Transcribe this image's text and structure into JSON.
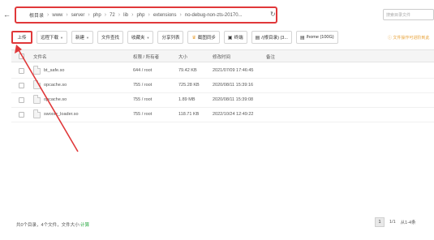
{
  "path": {
    "segments": [
      "根目录",
      "www",
      "server",
      "php",
      "72",
      "lib",
      "php",
      "extensions",
      "no-debug-non-zts-20170..."
    ]
  },
  "search": {
    "placeholder": "搜索目录文件"
  },
  "toolbar": {
    "upload": "上传",
    "remote_download": "远程下载",
    "new": "新建",
    "file_search": "文件查找",
    "favorites": "收藏夹",
    "share_list": "分享列表",
    "web_sync": "截图同步",
    "terminal": "终端",
    "disk_root": "/(根目录) (3...",
    "disk_home": "/home (100G)"
  },
  "hint": "文件操作可进阶到此",
  "table": {
    "headers": {
      "name": "文件名",
      "permission": "权限 / 所有者",
      "size": "大小",
      "modified": "修改时间",
      "remark": "备注"
    },
    "rows": [
      {
        "name": "bt_safe.so",
        "permission": "644 / root",
        "size": "79.42 KB",
        "modified": "2021/07/09 17:46:45"
      },
      {
        "name": "opcache.so",
        "permission": "755 / root",
        "size": "725.28 KB",
        "modified": "2020/08/11 15:39:16"
      },
      {
        "name": "opcache.so",
        "permission": "755 / root",
        "size": "1.89 MB",
        "modified": "2020/08/11 15:39:08"
      },
      {
        "name": "swoole_loader.so",
        "permission": "755 / root",
        "size": "118.71 KB",
        "modified": "2022/10/24 12:49:22"
      }
    ]
  },
  "footer": {
    "summary": "共0个目录，4个文件，文件大小:",
    "summary_action": "计算",
    "page": "1",
    "page_total": "1/1",
    "range": "从1-4条"
  },
  "colors": {
    "highlight": "#e0383a",
    "accent_green": "#20a53a",
    "hint_orange": "#e8a33b"
  }
}
